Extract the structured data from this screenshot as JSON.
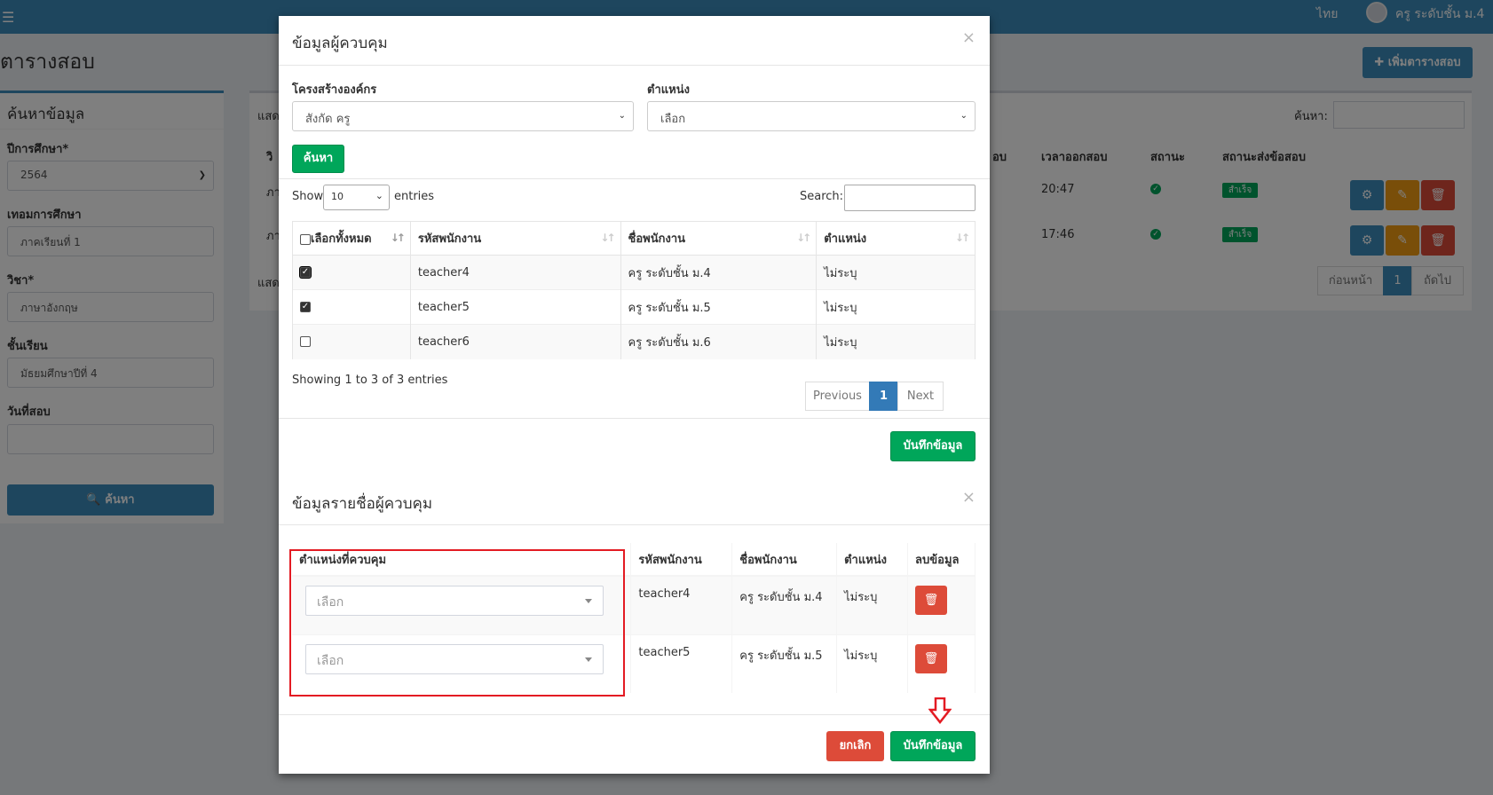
{
  "topbar": {
    "menu_icon": "☰",
    "lang": "ไทย",
    "username": "ครู ระดับชั้น ม.4"
  },
  "background": {
    "page_title": "ตารางสอบ",
    "add_button": "✚ เพิ่มตารางสอบ",
    "sidebar": {
      "title": "ค้นหาข้อมูล",
      "year_label": "ปีการศึกษา*",
      "year_value": "2564",
      "term_label": "เทอมการศึกษา",
      "term_value": "ภาคเรียนที่ 1",
      "subject_label": "วิชา*",
      "subject_value": "ภาษาอังกฤษ",
      "class_label": "ชั้นเรียน",
      "class_value": "มัธยมศึกษาปีที่ 4",
      "date_label": "วันที่สอบ",
      "search_button": "ค้นหา"
    },
    "table": {
      "search_label": "ค้นหา:",
      "show_prefix": "แสด",
      "col_first_clip": "วิ",
      "row_clip": "ภา",
      "headers": [
        "อบ",
        "เวลาออกสอบ",
        "สถานะ",
        "สถานะส่งข้อสอบ"
      ],
      "rows": [
        {
          "time": "20:47",
          "status_badge": "สำเร็จ"
        },
        {
          "time": "17:46",
          "status_badge": "สำเร็จ"
        }
      ],
      "footer_clip": "แสด",
      "pager": {
        "prev": "ก่อนหน้า",
        "page": "1",
        "next": "ถัดไป"
      }
    }
  },
  "modal": {
    "title": "ข้อมูลผู้ควบคุม",
    "close": "×",
    "org_label": "โครงสร้างองค์กร",
    "org_value": "สังกัด ครู",
    "position_label": "ตำแหน่ง",
    "position_value": "เลือก",
    "search_button": "ค้นหา",
    "show_label": "Show",
    "show_value": "10",
    "entries_label": "entries",
    "search_label": "Search:",
    "table_headers": [
      "เลือกทั้งหมด",
      "รหัสพนักงาน",
      "ชื่อพนักงาน",
      "ตำแหน่ง"
    ],
    "rows": [
      {
        "id": "teacher4",
        "name": "ครู ระดับชั้น ม.4",
        "position": "ไม่ระบุ",
        "checked": true
      },
      {
        "id": "teacher5",
        "name": "ครู ระดับชั้น ม.5",
        "position": "ไม่ระบุ",
        "checked": true
      },
      {
        "id": "teacher6",
        "name": "ครู ระดับชั้น ม.6",
        "position": "ไม่ระบุ",
        "checked": false
      }
    ],
    "info": "Showing 1 to 3 of 3 entries",
    "pager": {
      "prev": "Previous",
      "page": "1",
      "next": "Next"
    },
    "save_button": "บันทึกข้อมูล",
    "list_title": "ข้อมูลรายชื่อผู้ควบคุม",
    "list_close": "×",
    "list_headers": [
      "ตำแหน่งที่ควบคุม",
      "รหัสพนักงาน",
      "ชื่อพนักงาน",
      "ตำแหน่ง",
      "ลบข้อมูล"
    ],
    "list_rows": [
      {
        "control": "เลือก",
        "id": "teacher4",
        "name": "ครู ระดับชั้น ม.4",
        "position": "ไม่ระบุ"
      },
      {
        "control": "เลือก",
        "id": "teacher5",
        "name": "ครู ระดับชั้น ม.5",
        "position": "ไม่ระบุ"
      }
    ],
    "cancel_button": "ยกเลิก",
    "final_save_button": "บันทึกข้อมูล"
  },
  "colors": {
    "primary": "#3c8dbc",
    "success": "#00a65a",
    "danger": "#dd4b39",
    "warning": "#f39c12",
    "highlight": "#e31b23"
  }
}
